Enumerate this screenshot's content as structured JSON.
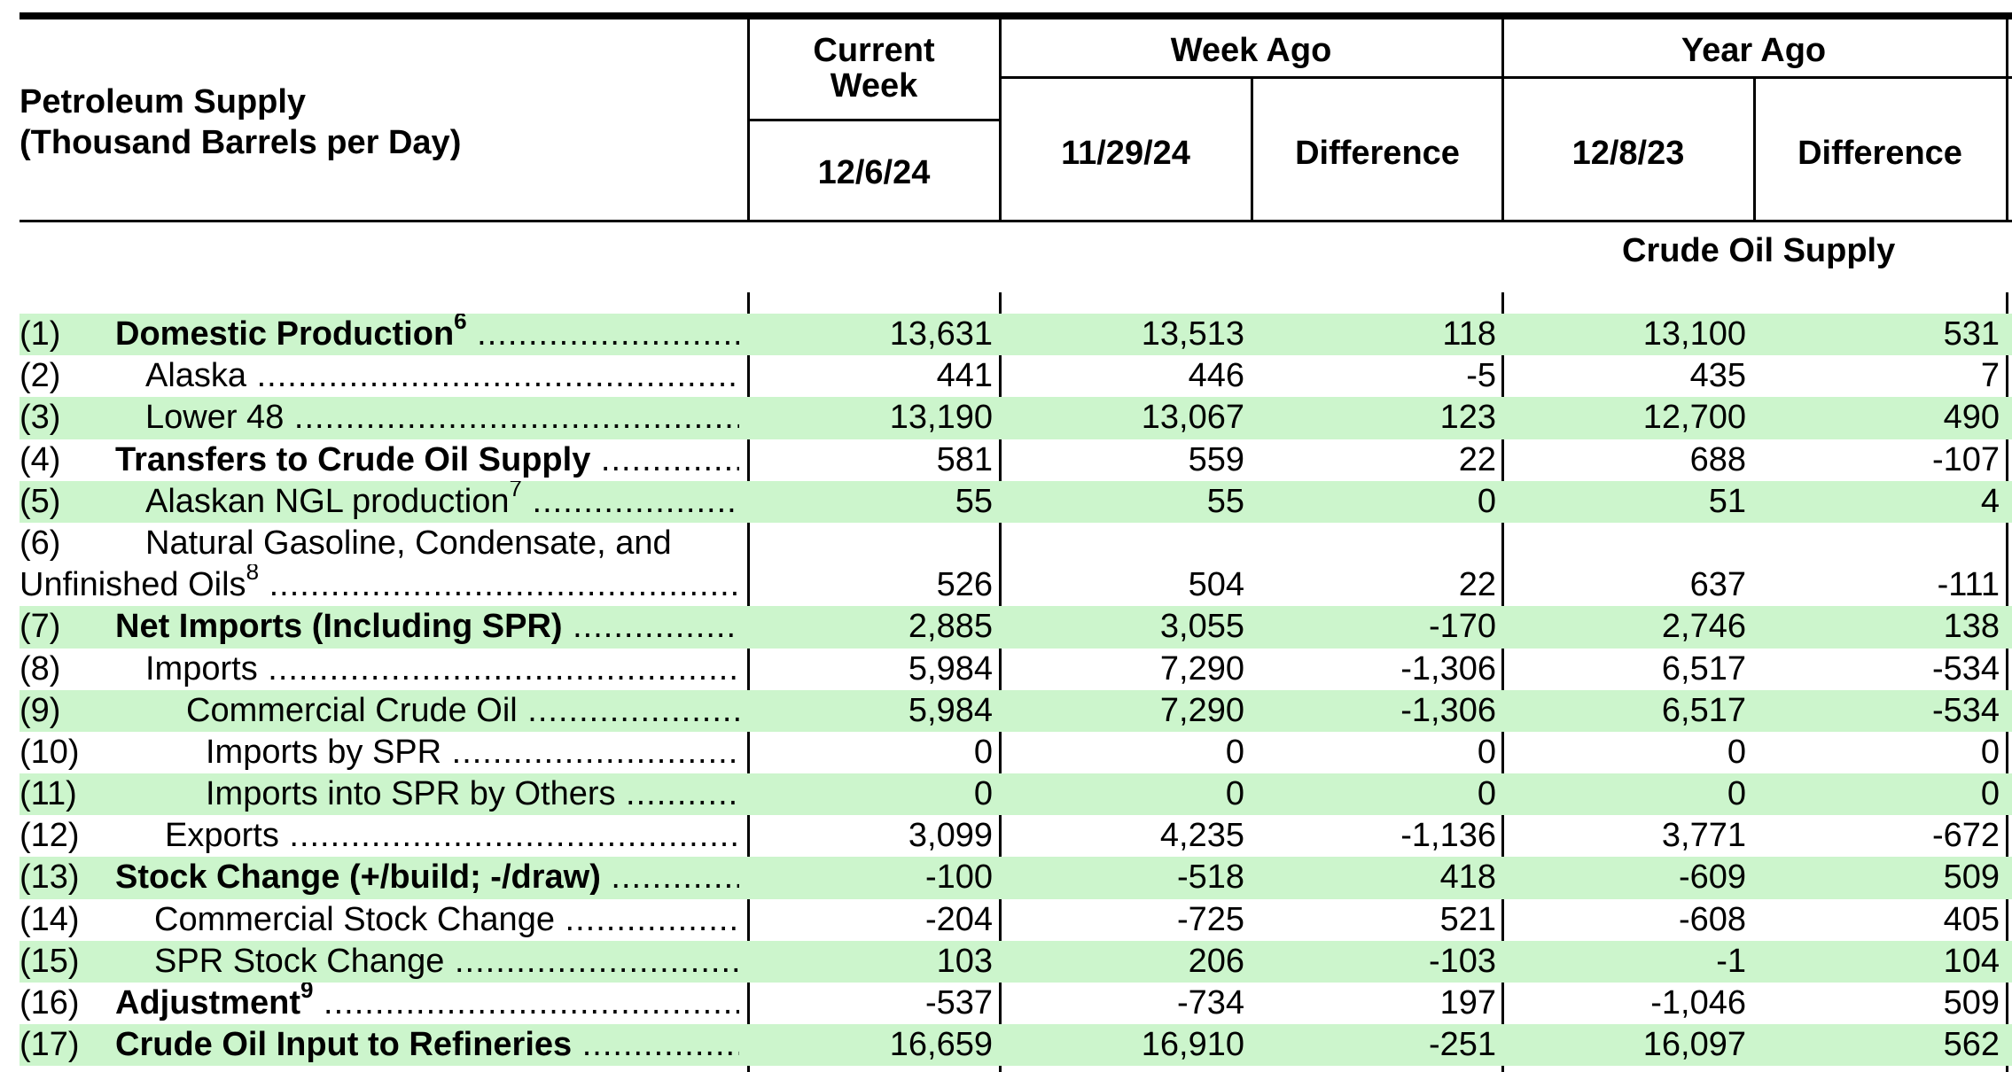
{
  "header": {
    "title_line1": "Petroleum Supply",
    "title_line2": "(Thousand Barrels per Day)",
    "current_week_line1": "Current",
    "current_week_line2": "Week",
    "current_week_date": "12/6/24",
    "week_ago": "Week Ago",
    "week_ago_date": "11/29/24",
    "week_ago_diff": "Difference",
    "year_ago": "Year Ago",
    "year_ago_date": "12/8/23",
    "year_ago_diff": "Difference"
  },
  "section_title": "Crude Oil Supply",
  "rows": [
    {
      "id": "(1)",
      "label": "Domestic Production",
      "sup": "6",
      "bold": true,
      "indent": 0,
      "values": [
        "13,631",
        "13,513",
        "118",
        "13,100",
        "531"
      ]
    },
    {
      "id": "(2)",
      "label": "Alaska",
      "sup": "",
      "bold": false,
      "indent": 1,
      "values": [
        "441",
        "446",
        "-5",
        "435",
        "7"
      ]
    },
    {
      "id": "(3)",
      "label": "Lower 48",
      "sup": "",
      "bold": false,
      "indent": 1,
      "values": [
        "13,190",
        "13,067",
        "123",
        "12,700",
        "490"
      ]
    },
    {
      "id": "(4)",
      "label": "Transfers to Crude Oil Supply",
      "sup": "",
      "bold": true,
      "indent": 0,
      "values": [
        "581",
        "559",
        "22",
        "688",
        "-107"
      ]
    },
    {
      "id": "(5)",
      "label": "Alaskan NGL production",
      "sup": "7",
      "bold": false,
      "indent": 1,
      "values": [
        "55",
        "55",
        "0",
        "51",
        "4"
      ]
    },
    {
      "id": "(6)",
      "label": "Natural Gasoline, Condensate, and",
      "label2": "Unfinished Oils",
      "sup": "8",
      "bold": false,
      "indent": 1,
      "values": [
        "526",
        "504",
        "22",
        "637",
        "-111"
      ]
    },
    {
      "id": "(7)",
      "label": "Net Imports (Including SPR)",
      "sup": "",
      "bold": true,
      "indent": 0,
      "values": [
        "2,885",
        "3,055",
        "-170",
        "2,746",
        "138"
      ]
    },
    {
      "id": "(8)",
      "label": "Imports",
      "sup": "",
      "bold": false,
      "indent": 1,
      "values": [
        "5,984",
        "7,290",
        "-1,306",
        "6,517",
        "-534"
      ]
    },
    {
      "id": "(9)",
      "label": "Commercial Crude Oil",
      "sup": "",
      "bold": false,
      "indent": 2,
      "values": [
        "5,984",
        "7,290",
        "-1,306",
        "6,517",
        "-534"
      ]
    },
    {
      "id": "(10)",
      "label": "Imports by SPR",
      "sup": "",
      "bold": false,
      "indent": 3,
      "values": [
        "0",
        "0",
        "0",
        "0",
        "0"
      ]
    },
    {
      "id": "(11)",
      "label": "Imports into SPR by Others",
      "sup": "",
      "bold": false,
      "indent": 3,
      "values": [
        "0",
        "0",
        "0",
        "0",
        "0"
      ]
    },
    {
      "id": "(12)",
      "label": "Exports",
      "sup": "",
      "bold": false,
      "indent": 4,
      "values": [
        "3,099",
        "4,235",
        "-1,136",
        "3,771",
        "-672"
      ]
    },
    {
      "id": "(13)",
      "label": "Stock Change (+/build; -/draw)",
      "sup": "",
      "bold": true,
      "indent": 0,
      "values": [
        "-100",
        "-518",
        "418",
        "-609",
        "509"
      ]
    },
    {
      "id": "(14)",
      "label": "Commercial Stock Change",
      "sup": "",
      "bold": false,
      "indent": 5,
      "values": [
        "-204",
        "-725",
        "521",
        "-608",
        "405"
      ]
    },
    {
      "id": "(15)",
      "label": "SPR Stock Change",
      "sup": "",
      "bold": false,
      "indent": 5,
      "values": [
        "103",
        "206",
        "-103",
        "-1",
        "104"
      ]
    },
    {
      "id": "(16)",
      "label": "Adjustment",
      "sup": "9",
      "bold": true,
      "indent": 0,
      "values": [
        "-537",
        "-734",
        "197",
        "-1,046",
        "509"
      ]
    },
    {
      "id": "(17)",
      "label": "Crude Oil Input to Refineries",
      "sup": "",
      "bold": true,
      "indent": 0,
      "values": [
        "16,659",
        "16,910",
        "-251",
        "16,097",
        "562"
      ]
    }
  ]
}
